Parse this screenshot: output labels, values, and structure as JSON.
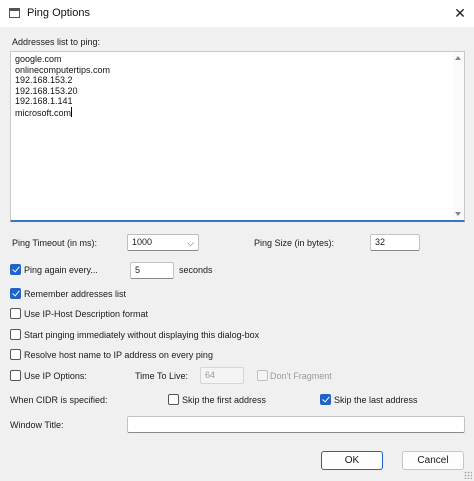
{
  "window": {
    "title": "Ping Options"
  },
  "addresses": {
    "label": "Addresses list to ping:",
    "lines": [
      "google.com",
      "onlinecomputertips.com",
      "192.168.153.2",
      "192.168.153.20",
      "192.168.1.141",
      "microsoft.com"
    ]
  },
  "ping_timeout": {
    "label": "Ping Timeout (in ms):",
    "value": "1000"
  },
  "ping_size": {
    "label": "Ping Size (in bytes):",
    "value": "32"
  },
  "ping_again": {
    "label": "Ping again every...",
    "checked": true,
    "value": "5",
    "unit": "seconds"
  },
  "options": {
    "remember": {
      "label": "Remember addresses list",
      "checked": true
    },
    "ip_host": {
      "label": "Use IP-Host Description format",
      "checked": false
    },
    "start_immediately": {
      "label": "Start pinging immediately without displaying this dialog-box",
      "checked": false
    },
    "resolve": {
      "label": "Resolve host name to IP address on every ping",
      "checked": false
    },
    "ip_options": {
      "label": "Use IP Options:",
      "checked": false
    }
  },
  "ttl": {
    "label": "Time To Live:",
    "value": "64"
  },
  "dont_fragment": {
    "label": "Don't Fragment",
    "checked": false
  },
  "cidr": {
    "label": "When CIDR is specified:",
    "skip_first": {
      "label": "Skip the first address",
      "checked": false
    },
    "skip_last": {
      "label": "Skip the last address",
      "checked": true
    }
  },
  "window_title": {
    "label": "Window Title:",
    "value": ""
  },
  "buttons": {
    "ok": "OK",
    "cancel": "Cancel"
  },
  "icons": {
    "close": "close-icon",
    "dropdown": "chevron-down-icon",
    "app": "app-window-icon"
  },
  "colors": {
    "accent": "#1f62c8"
  }
}
